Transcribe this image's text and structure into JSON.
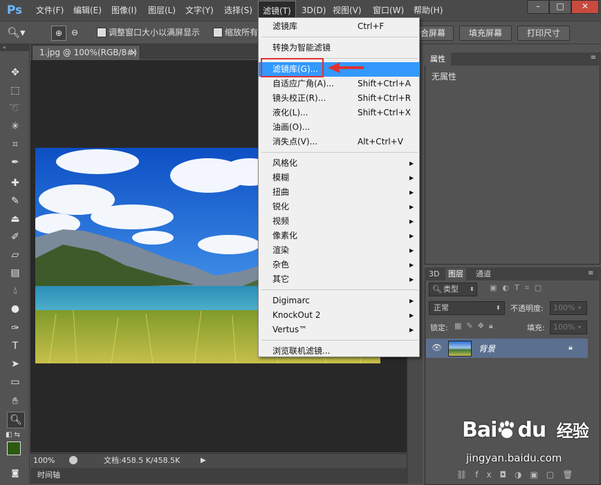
{
  "app": {
    "logo": "Ps"
  },
  "menubar": {
    "items": [
      "文件(F)",
      "编辑(E)",
      "图像(I)",
      "图层(L)",
      "文字(Y)",
      "选择(S)",
      "滤镜(T)",
      "3D(D)",
      "视图(V)",
      "窗口(W)",
      "帮助(H)"
    ],
    "active_index": 6,
    "window_buttons": [
      "–",
      "□",
      "✕"
    ]
  },
  "options_bar": {
    "resize_window_label": "调整窗口大小以满屏显示",
    "zoom_all_label": "缩放所有",
    "fit_screen_label": "合屏幕",
    "fill_screen_label": "填充屏幕",
    "print_size_label": "打印尺寸"
  },
  "document": {
    "tab_title": "1.jpg @ 100%(RGB/8#)",
    "tab_close": "×",
    "zoom": "100%",
    "doc_info": "文档:458.5 K/458.5K",
    "timeline_label": "时间轴"
  },
  "filter_menu": {
    "items": [
      {
        "label": "滤镜库",
        "shortcut": "Ctrl+F",
        "submenu": false
      },
      {
        "sep": true
      },
      {
        "label": "转换为智能滤镜",
        "shortcut": "",
        "submenu": false
      },
      {
        "sep": true
      },
      {
        "label": "滤镜库(G)...",
        "shortcut": "",
        "submenu": false,
        "highlight": true
      },
      {
        "label": "自适应广角(A)...",
        "shortcut": "Shift+Ctrl+A",
        "submenu": false
      },
      {
        "label": "镜头校正(R)...",
        "shortcut": "Shift+Ctrl+R",
        "submenu": false
      },
      {
        "label": "液化(L)...",
        "shortcut": "Shift+Ctrl+X",
        "submenu": false
      },
      {
        "label": "油画(O)...",
        "shortcut": "",
        "submenu": false
      },
      {
        "label": "消失点(V)...",
        "shortcut": "Alt+Ctrl+V",
        "submenu": false
      },
      {
        "sep": true
      },
      {
        "label": "风格化",
        "shortcut": "",
        "submenu": true
      },
      {
        "label": "模糊",
        "shortcut": "",
        "submenu": true
      },
      {
        "label": "扭曲",
        "shortcut": "",
        "submenu": true
      },
      {
        "label": "锐化",
        "shortcut": "",
        "submenu": true
      },
      {
        "label": "视频",
        "shortcut": "",
        "submenu": true
      },
      {
        "label": "像素化",
        "shortcut": "",
        "submenu": true
      },
      {
        "label": "渲染",
        "shortcut": "",
        "submenu": true
      },
      {
        "label": "杂色",
        "shortcut": "",
        "submenu": true
      },
      {
        "label": "其它",
        "shortcut": "",
        "submenu": true
      },
      {
        "sep": true
      },
      {
        "label": "Digimarc",
        "shortcut": "",
        "submenu": true
      },
      {
        "label": "KnockOut 2",
        "shortcut": "",
        "submenu": true
      },
      {
        "label": "Vertus™",
        "shortcut": "",
        "submenu": true
      },
      {
        "sep": true
      },
      {
        "label": "浏览联机滤镜...",
        "shortcut": "",
        "submenu": false
      }
    ]
  },
  "properties_panel": {
    "tab": "属性",
    "empty_text": "无属性"
  },
  "layers_panel": {
    "tabs": [
      "3D",
      "图层",
      "通道"
    ],
    "active_tab": 1,
    "filter_kind": "类型",
    "blend_mode": "正常",
    "opacity_label": "不透明度:",
    "opacity_value": "100%",
    "lock_label": "锁定:",
    "fill_label": "填充:",
    "fill_value": "100%",
    "layer_name": "背景"
  },
  "watermark": {
    "brand": "Bai",
    "brand2": "du",
    "cn": "经验",
    "url": "jingyan.baidu.com"
  },
  "colors": {
    "accent": "#3399ff",
    "red_marker": "#e03030",
    "fg_color": "#2d5a12",
    "bg_color": "#ffffff"
  }
}
